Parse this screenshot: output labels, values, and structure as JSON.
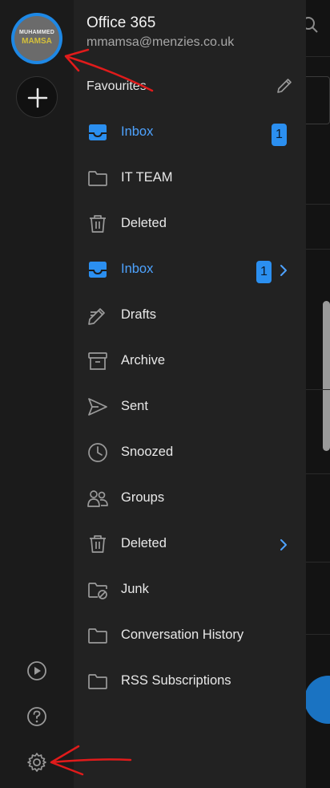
{
  "account": {
    "title": "Office 365",
    "email": "mmamsa@menzies.co.uk",
    "avatar_line1": "MUHAMMED",
    "avatar_line2": "MAMSA"
  },
  "favourites_label": "Favourites",
  "folders": [
    {
      "label": "Inbox",
      "icon": "inbox-icon",
      "active": true,
      "badge": "1"
    },
    {
      "label": "IT TEAM",
      "icon": "folder-icon"
    },
    {
      "label": "Deleted",
      "icon": "trash-icon"
    },
    {
      "label": "Inbox",
      "icon": "inbox-icon",
      "active": true,
      "badge": "1",
      "chevron": true
    },
    {
      "label": "Drafts",
      "icon": "pencil-icon"
    },
    {
      "label": "Archive",
      "icon": "archive-icon"
    },
    {
      "label": "Sent",
      "icon": "send-icon"
    },
    {
      "label": "Snoozed",
      "icon": "clock-icon"
    },
    {
      "label": "Groups",
      "icon": "groups-icon"
    },
    {
      "label": "Deleted",
      "icon": "trash-icon",
      "chevron": true
    },
    {
      "label": "Junk",
      "icon": "junk-icon"
    },
    {
      "label": "Conversation History",
      "icon": "folder-icon"
    },
    {
      "label": "RSS Subscriptions",
      "icon": "folder-icon"
    }
  ],
  "colors": {
    "accent": "#2b8ff0",
    "annotation": "#e01b1b"
  }
}
